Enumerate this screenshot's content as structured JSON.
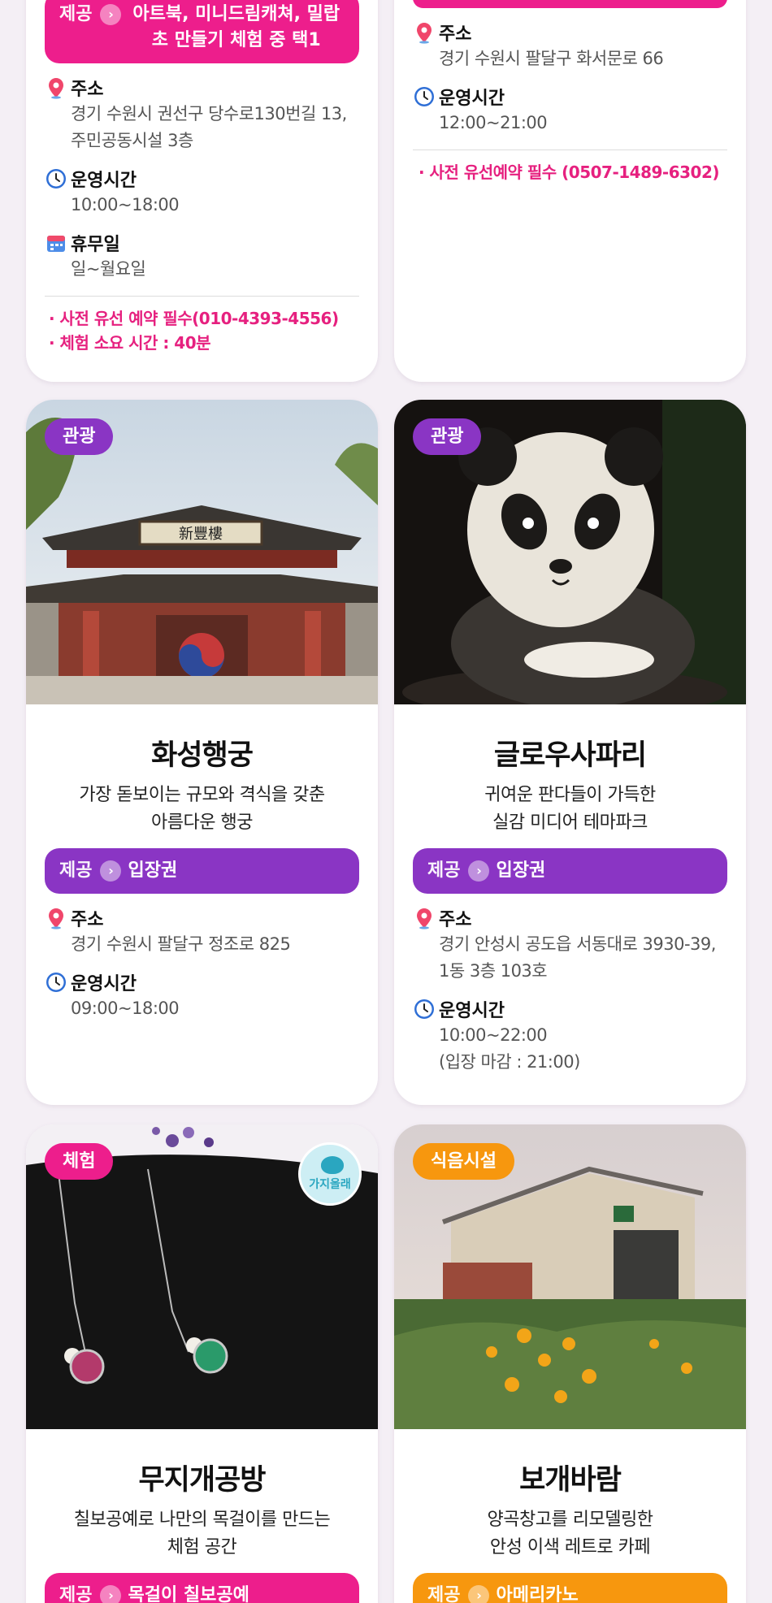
{
  "colors": {
    "pink": "#ed1e8c",
    "purple": "#8a35c4",
    "orange": "#f7970e",
    "note": "#e6207f"
  },
  "labels": {
    "provide": "제공",
    "address": "주소",
    "hours": "운영시간",
    "closed": "휴무일"
  },
  "card1": {
    "provide_value": "아트북, 미니드림캐쳐, 밀랍초 만들기 체험 중 택1",
    "address": [
      "경기 수원시 권선구 당수로130번길 13,",
      "주민공동시설 3층"
    ],
    "hours": "10:00~18:00",
    "closed": "일~월요일",
    "notes": [
      "· 사전 유선 예약 필수(010-4393-4556)",
      "· 체험 소요 시간 : 40분"
    ]
  },
  "card2": {
    "address": "경기 수원시 팔달구 화서문로 66",
    "hours": "12:00~21:00",
    "notes": [
      "· 사전 유선예약 필수 (0507-1489-6302)"
    ]
  },
  "card3": {
    "tag": "관광",
    "title": "화성행궁",
    "desc": [
      "가장 돋보이는 규모와 격식을 갖춘",
      "아름다운 행궁"
    ],
    "provide_value": "입장권",
    "address": "경기 수원시 팔달구 정조로 825",
    "hours": "09:00~18:00",
    "image_sign": "新豐樓"
  },
  "card4": {
    "tag": "관광",
    "title": "글로우사파리",
    "desc": [
      "귀여운 판다들이 가득한",
      "실감 미디어 테마파크"
    ],
    "provide_value": "입장권",
    "address": [
      "경기 안성시 공도읍 서동대로 3930-39,",
      "1동 3층 103호"
    ],
    "hours": [
      "10:00~22:00",
      "(입장 마감 : 21:00)"
    ]
  },
  "card5": {
    "tag": "체험",
    "logo_text": "가지올래",
    "title": "무지개공방",
    "desc": [
      "칠보공예로 나만의 목걸이를 만드는",
      "체험 공간"
    ],
    "provide_value": "목걸이 칠보공예"
  },
  "card6": {
    "tag": "식음시설",
    "title": "보개바람",
    "desc": [
      "양곡창고를 리모델링한",
      "안성 이색 레트로 카페"
    ],
    "provide_value": "아메리카노"
  },
  "icons": [
    "location-pin-icon",
    "clock-icon",
    "calendar-icon",
    "chevron-right-icon"
  ]
}
